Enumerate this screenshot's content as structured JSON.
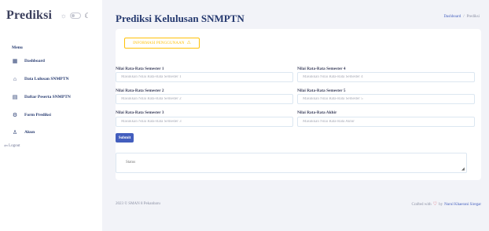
{
  "app": {
    "brand": "Prediksi",
    "sun_icon": "☼",
    "moon_icon": "☾"
  },
  "sidebar": {
    "menu_heading": "Menu",
    "items": [
      {
        "label": "Dashboard",
        "icon": "grid-icon",
        "glyph": "▦"
      },
      {
        "label": "Data Lulusan SNMPTN",
        "icon": "bank-icon",
        "glyph": "⌂"
      },
      {
        "label": "Daftar Peserta SNMPTN",
        "icon": "table-icon",
        "glyph": "▤"
      },
      {
        "label": "Form Prediksi",
        "icon": "gear-icon",
        "glyph": "⚙"
      },
      {
        "label": "Akun",
        "icon": "user-icon",
        "glyph": "♙"
      }
    ],
    "logout_label": "Logout",
    "logout_glyph": "⇦"
  },
  "header": {
    "title": "Prediksi Kelulusan SNMPTN",
    "breadcrumb": [
      "Dashboard",
      "/",
      "Prediksi"
    ]
  },
  "form": {
    "info_button_label": "INFORMASI PENGGUNAAN",
    "info_icon": "⚠",
    "fields": [
      {
        "label": "Nilai Rata-Rata Semester 1",
        "placeholder": "Masukkan Nilai Rata-Rata Semester 1"
      },
      {
        "label": "Nilai Rata-Rata Semester 2",
        "placeholder": "Masukkan Nilai Rata-Rata Semester 2"
      },
      {
        "label": "Nilai Rata-Rata Semester 3",
        "placeholder": "Masukkan Nilai Rata-Rata Semester 3"
      },
      {
        "label": "Nilai Rata-Rata Semester 4",
        "placeholder": "Masukkan Nilai Rata-Rata Semester 4"
      },
      {
        "label": "Nilai Rata-Rata Semester 5",
        "placeholder": "Masukkan Nilai Rata-Rata Semester 5"
      },
      {
        "label": "Nilai Rata-Rata Akhir",
        "placeholder": "Masukkan Nilai Rata-Rata Akhir"
      }
    ],
    "submit_label": "Submit",
    "status_placeholder": "Status"
  },
  "footer": {
    "copyright": "2023 © SMAN 8 Pekanbaru",
    "crafted_prefix": "Crafted with",
    "heart": "♡",
    "crafted_by": "by",
    "author": "Nurul Khaerani Siregar"
  },
  "colors": {
    "primary": "#435ebe",
    "warning": "#ffc107",
    "heading": "#25396f",
    "background": "#f2f3f8"
  }
}
